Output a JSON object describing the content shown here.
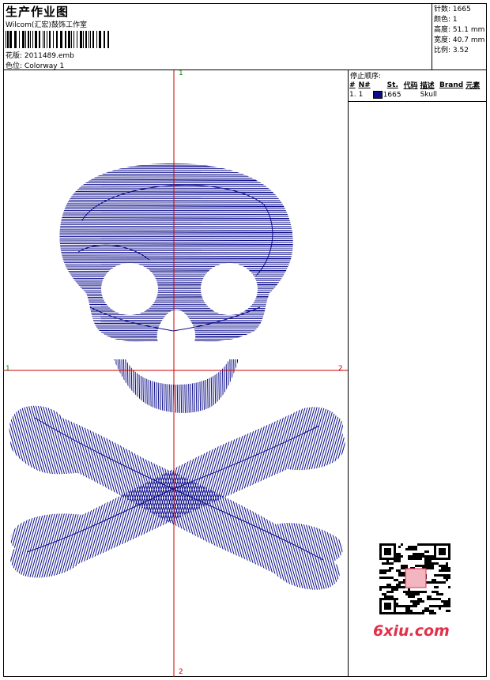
{
  "header": {
    "title": "生产作业图",
    "company": "Wilcom(汇宏)鼓饰工作室",
    "design_label": "花版:",
    "design_value": "2011489.emb",
    "colorway_label": "色位:",
    "colorway_value": "Colorway 1"
  },
  "stats": [
    {
      "label": "针数:",
      "value": "1665"
    },
    {
      "label": "颜色:",
      "value": "1"
    },
    {
      "label": "高度:",
      "value": "51.1 mm"
    },
    {
      "label": "宽度:",
      "value": "40.7 mm"
    },
    {
      "label": "比例:",
      "value": "3.52"
    }
  ],
  "stop_sequence": {
    "title": "停止顺序:",
    "headers": [
      "#",
      "N#",
      "St.",
      "代码",
      "描述",
      "Brand",
      "元素"
    ],
    "rows": [
      {
        "index": "1.",
        "number": "1",
        "stitches": "1665",
        "code": "",
        "description": "Skull",
        "brand": "",
        "element": ""
      }
    ],
    "swatch_color": "#0b0b8a"
  },
  "guides": {
    "top": "1",
    "left": "1",
    "right": "2",
    "bottom": "2",
    "color": "#cc0000"
  },
  "embroidery_color": "#0b0b8a",
  "watermark": {
    "text": "6xiu.com",
    "color": "#e0304a"
  }
}
